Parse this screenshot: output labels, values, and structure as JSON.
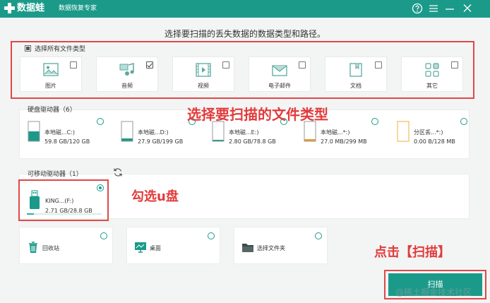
{
  "app": {
    "name": "数据蛙",
    "tagline": "数据恢复专家"
  },
  "heading": "选择要扫描的丢失数据的数据类型和路径。",
  "file_types": {
    "select_all_label": "选择所有文件类型",
    "items": [
      {
        "label": "图片",
        "icon": "image-icon",
        "checked": false
      },
      {
        "label": "音频",
        "icon": "music-icon",
        "checked": true
      },
      {
        "label": "视频",
        "icon": "video-icon",
        "checked": false
      },
      {
        "label": "电子邮件",
        "icon": "email-icon",
        "checked": false
      },
      {
        "label": "文档",
        "icon": "document-icon",
        "checked": false
      },
      {
        "label": "其它",
        "icon": "other-icon",
        "checked": false
      }
    ]
  },
  "hard_drives": {
    "title": "硬盘驱动器（6）",
    "items": [
      {
        "name": "本地磁...C:)",
        "size": "59.8 GB/120 GB",
        "used_fraction": 0.5,
        "color": "#1b9a8a"
      },
      {
        "name": "本地磁...D:)",
        "size": "27.9 GB/199 GB",
        "used_fraction": 0.14,
        "color": "#1b9a8a"
      },
      {
        "name": "本地磁...E:)",
        "size": "2.80 GB/78.8 GB",
        "used_fraction": 0.04,
        "color": "#1b9a8a"
      },
      {
        "name": "本地磁...*:)",
        "size": "27.0 MB/299 MB",
        "used_fraction": 0.09,
        "color": "#f29a2e"
      },
      {
        "name": "分区丢...*:)",
        "size": "0.00  B/128 MB",
        "used_fraction": 0.0,
        "color": "#f2b233"
      }
    ]
  },
  "removable_drives": {
    "title": "可移动驱动器（1）",
    "items": [
      {
        "name": "KING...(F:)",
        "size": "2.71 GB/28.8 GB",
        "used_fraction": 0.09,
        "selected": true
      }
    ]
  },
  "locations": [
    {
      "label": "回收站",
      "icon": "recycle-bin-icon"
    },
    {
      "label": "桌面",
      "icon": "desktop-icon"
    },
    {
      "label": "选择文件夹",
      "icon": "folder-icon"
    }
  ],
  "annotations": {
    "file_types": "选择要扫描的文件类型",
    "usb": "勾选u盘",
    "scan": "点击【扫描】"
  },
  "scan_button_label": "扫描",
  "watermark": "@稀土掘金技术社区",
  "colors": {
    "brand": "#1b9a8a",
    "annotation": "#e23b3b"
  }
}
